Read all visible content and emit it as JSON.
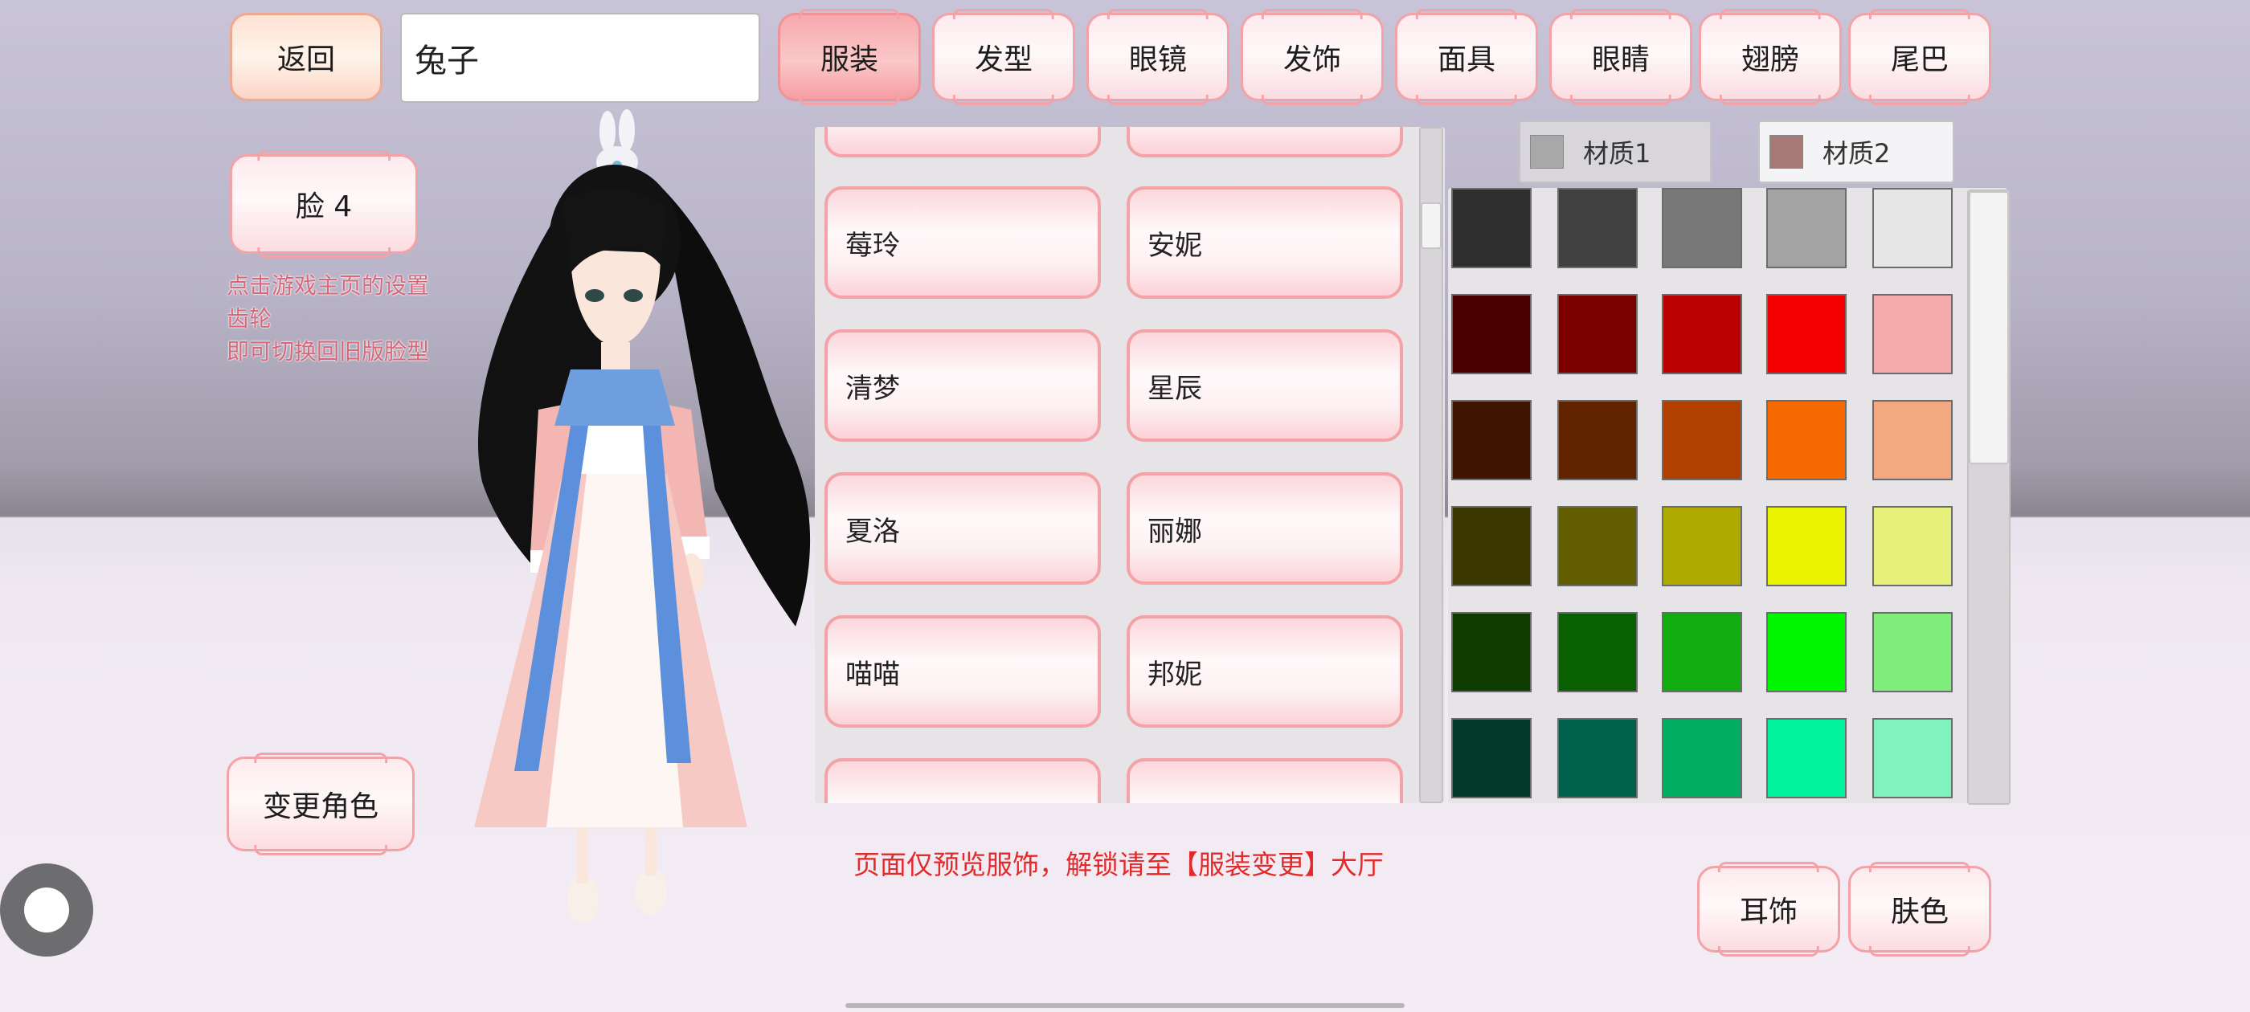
{
  "topbar": {
    "back_label": "返回",
    "name_value": "兔子",
    "tabs": [
      "服装",
      "发型",
      "眼镜",
      "发饰",
      "面具",
      "眼睛",
      "翅膀",
      "尾巴"
    ],
    "active_tab": "服装"
  },
  "left": {
    "face_label": "脸 4",
    "hint_lines": [
      "点击游戏主页的设置",
      "齿轮",
      "即可切换回旧版脸型"
    ],
    "change_char_label": "变更角色"
  },
  "outfits": {
    "rows": [
      [
        "",
        ""
      ],
      [
        "莓玲",
        "安妮"
      ],
      [
        "清梦",
        "星辰"
      ],
      [
        "夏洛",
        "丽娜"
      ],
      [
        "喵喵",
        "邦妮"
      ],
      [
        "",
        ""
      ]
    ]
  },
  "materials": {
    "tab1_label": "材质1",
    "tab2_label": "材质2",
    "tab1_color": "#a8a8a8",
    "tab2_color": "#a77878"
  },
  "palette": [
    [
      "#2e2e2e",
      "#404040",
      "#787878",
      "#a3a3a3",
      "#e6e6e6"
    ],
    [
      "#4a0000",
      "#7c0000",
      "#bb0000",
      "#f40000",
      "#f3abab"
    ],
    [
      "#3f1400",
      "#622300",
      "#b03f00",
      "#f56900",
      "#f3a980"
    ],
    [
      "#3c3600",
      "#625e00",
      "#aeaa00",
      "#e9f300",
      "#e8f07c"
    ],
    [
      "#0f3c00",
      "#086000",
      "#10ac10",
      "#00f700",
      "#80ee7c"
    ],
    [
      "#00382a",
      "#00624c",
      "#00ae64",
      "#00f29c",
      "#80f2bd"
    ]
  ],
  "footer": {
    "notice": "页面仅预览服饰，解锁请至【服装变更】大厅",
    "ear_label": "耳饰",
    "skin_label": "肤色"
  }
}
